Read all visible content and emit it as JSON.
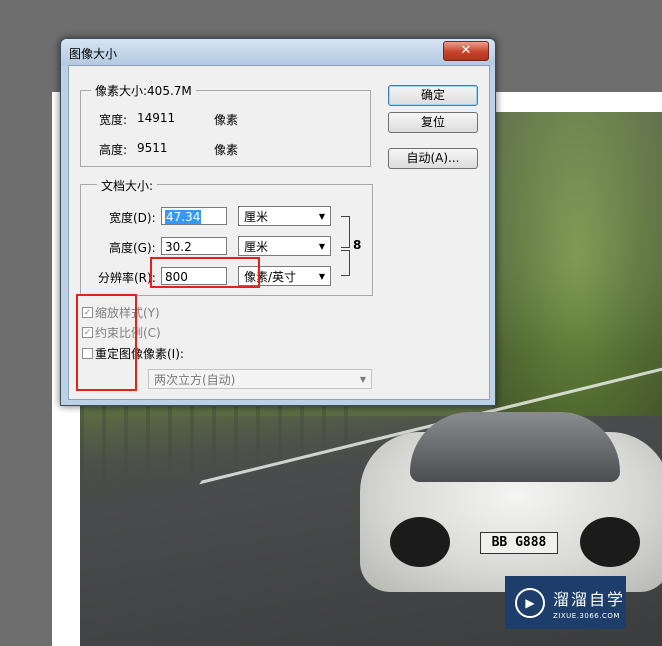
{
  "dialog": {
    "title": "图像大小",
    "close_glyph": "✕"
  },
  "pixel_dims": {
    "legend": "像素大小:405.7M",
    "width_label": "宽度:",
    "width_value": "14911",
    "width_unit": "像素",
    "height_label": "高度:",
    "height_value": "9511",
    "height_unit": "像素"
  },
  "doc_size": {
    "legend": "文档大小:",
    "width_label": "宽度(D):",
    "width_value": "47.34",
    "width_unit": "厘米",
    "height_label": "高度(G):",
    "height_value": "30.2",
    "height_unit": "厘米",
    "res_label": "分辨率(R):",
    "res_value": "800",
    "res_unit": "像素/英寸",
    "link_icon": "chain-link-icon"
  },
  "buttons": {
    "ok": "确定",
    "reset": "复位",
    "auto": "自动(A)..."
  },
  "options": {
    "scale_styles": "缩放样式(Y)",
    "scale_styles_checked": true,
    "constrain": "约束比例(C)",
    "constrain_checked": true,
    "resample": "重定图像像素(I):",
    "resample_checked": false,
    "method": "两次立方(自动)"
  },
  "photo": {
    "plate": "BB G888"
  },
  "watermark": {
    "name": "溜溜自学",
    "url": "ZIXUE.3066.COM"
  },
  "colors": {
    "highlight_box": "#e2231a",
    "selection": "#3399ff"
  }
}
